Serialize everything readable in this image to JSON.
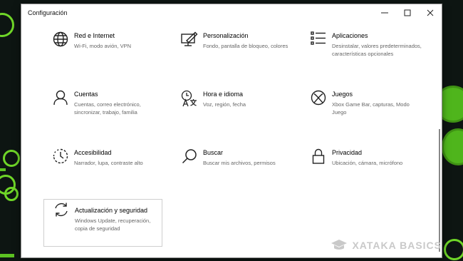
{
  "window": {
    "title": "Configuración"
  },
  "tiles": [
    {
      "name": "Red e Internet",
      "desc": "Wi-Fi, modo avión, VPN",
      "icon": "globe-icon"
    },
    {
      "name": "Personalización",
      "desc": "Fondo, pantalla de bloqueo, colores",
      "icon": "personalization-icon"
    },
    {
      "name": "Aplicaciones",
      "desc": "Desinstalar, valores predeterminados, características opcionales",
      "icon": "apps-list-icon"
    },
    {
      "name": "Cuentas",
      "desc": "Cuentas, correo electrónico, sincronizar, trabajo, familia",
      "icon": "person-icon"
    },
    {
      "name": "Hora e idioma",
      "desc": "Voz, región, fecha",
      "icon": "time-language-icon"
    },
    {
      "name": "Juegos",
      "desc": "Xbox Game Bar, capturas, Modo Juego",
      "icon": "xbox-icon"
    },
    {
      "name": "Accesibilidad",
      "desc": "Narrador, lupa, contraste alto",
      "icon": "accessibility-icon"
    },
    {
      "name": "Buscar",
      "desc": "Buscar mis archivos, permisos",
      "icon": "search-icon"
    },
    {
      "name": "Privacidad",
      "desc": "Ubicación, cámara, micrófono",
      "icon": "lock-icon"
    },
    {
      "name": "Actualización y seguridad",
      "desc": "Windows Update, recuperación, copia de seguridad",
      "icon": "update-icon"
    }
  ],
  "watermark": {
    "text": "XATAKA BASICS",
    "icon": "graduation-cap-icon"
  },
  "colors": {
    "accent": "#5cc222"
  }
}
